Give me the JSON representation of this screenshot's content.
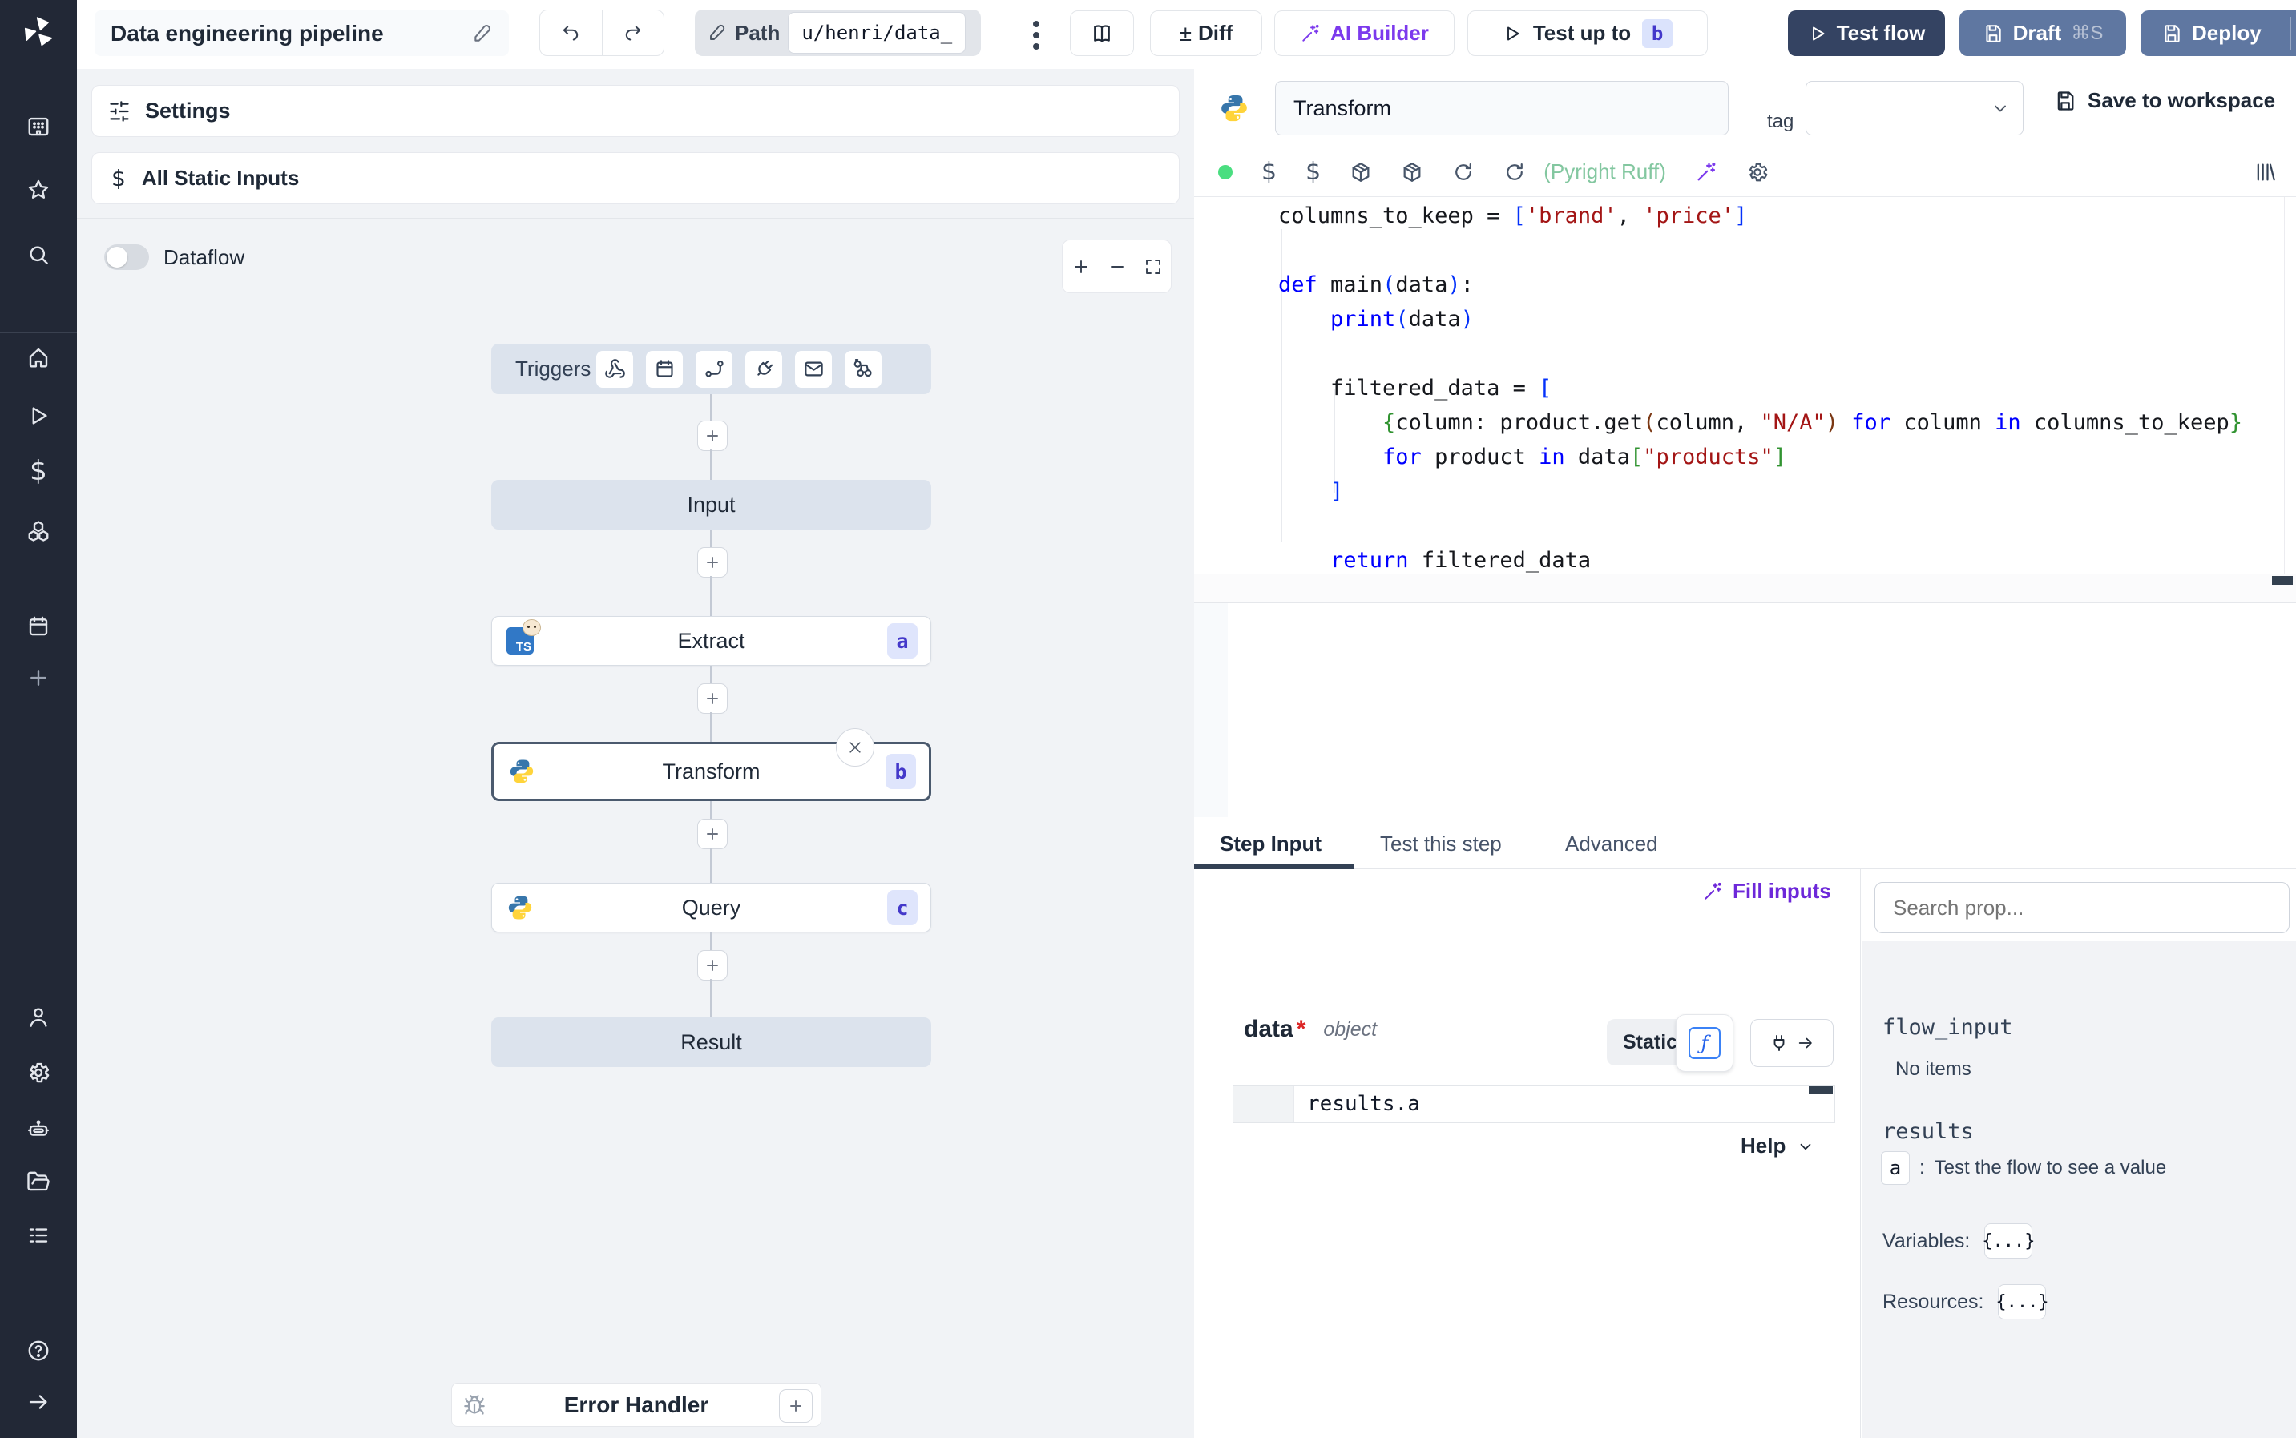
{
  "topbar": {
    "title": "Data engineering pipeline",
    "path_label": "Path",
    "path_value": "u/henri/data_",
    "book_button": "",
    "diff_label": "Diff",
    "diff_sign": "±",
    "ai_builder_label": "AI Builder",
    "test_up_to_label": "Test up to",
    "test_up_to_badge": "b",
    "test_flow_label": "Test flow",
    "draft_label": "Draft",
    "draft_shortcut": "⌘S",
    "deploy_label": "Deploy"
  },
  "sidebar": {
    "icons": [
      "windmill-logo",
      "workspace-grid",
      "favorites-star",
      "search",
      "home",
      "runs-play",
      "variables-dollar",
      "resources-cubes",
      "schedules-calendar",
      "add-plus",
      "user",
      "settings-gear",
      "workers-robot",
      "folders",
      "service-logs-list",
      "help",
      "expand-arrow"
    ]
  },
  "canvas": {
    "settings_label": "Settings",
    "static_inputs_label": "All Static Inputs",
    "static_inputs_icon": "$",
    "dataflow_label": "Dataflow",
    "triggers_label": "Triggers",
    "trigger_icons": [
      "webhook",
      "schedule-calendar",
      "http-route",
      "websocket-plug",
      "email",
      "poll"
    ],
    "nodes": {
      "input": "Input",
      "extract": {
        "label": "Extract",
        "badge": "a"
      },
      "transform": {
        "label": "Transform",
        "badge": "b"
      },
      "query": {
        "label": "Query",
        "badge": "c"
      },
      "result": "Result"
    },
    "error_handler_label": "Error Handler"
  },
  "editor": {
    "step_name": "Transform",
    "tag_label": "tag",
    "save_label": "Save to workspace",
    "lint_status": "(Pyright Ruff)",
    "toolbar_icons": [
      "status-dot",
      "dollar-vars",
      "dollar-vars",
      "package",
      "package",
      "reload",
      "reload",
      "magic-wand",
      "gear",
      "library-panel"
    ],
    "code": {
      "lines": [
        [
          [
            "columns_to_keep = ",
            "d"
          ],
          [
            "[",
            "b1"
          ],
          [
            "'brand'",
            "s"
          ],
          [
            ", ",
            "d"
          ],
          [
            "'price'",
            "s"
          ],
          [
            "]",
            "b1"
          ]
        ],
        [],
        [
          [
            "def",
            "k"
          ],
          [
            " main",
            "d"
          ],
          [
            "(",
            "b1"
          ],
          [
            "data",
            "d"
          ],
          [
            ")",
            "b1"
          ],
          [
            ":",
            "d"
          ]
        ],
        [
          [
            "    ",
            "d"
          ],
          [
            "print",
            "k"
          ],
          [
            "(",
            "b1"
          ],
          [
            "data",
            "d"
          ],
          [
            ")",
            "b1"
          ]
        ],
        [],
        [
          [
            "    filtered_data = ",
            "d"
          ],
          [
            "[",
            "b1"
          ]
        ],
        [
          [
            "        ",
            "d"
          ],
          [
            "{",
            "b2"
          ],
          [
            "column: product.get",
            "d"
          ],
          [
            "(",
            "b3"
          ],
          [
            "column, ",
            "d"
          ],
          [
            "\"N/A\"",
            "s"
          ],
          [
            ")",
            "b3"
          ],
          [
            " ",
            "d"
          ],
          [
            "for",
            "k"
          ],
          [
            " column ",
            "d"
          ],
          [
            "in",
            "k"
          ],
          [
            " columns_to_keep",
            "d"
          ],
          [
            "}",
            "b2"
          ]
        ],
        [
          [
            "        ",
            "d"
          ],
          [
            "for",
            "k"
          ],
          [
            " product ",
            "d"
          ],
          [
            "in",
            "k"
          ],
          [
            " data",
            "d"
          ],
          [
            "[",
            "b2"
          ],
          [
            "\"products\"",
            "s"
          ],
          [
            "]",
            "b2"
          ]
        ],
        [
          [
            "    ",
            "d"
          ],
          [
            "]",
            "b1"
          ]
        ],
        [],
        [
          [
            "    ",
            "d"
          ],
          [
            "return",
            "k"
          ],
          [
            " filtered_data",
            "d"
          ]
        ]
      ]
    }
  },
  "step_panel": {
    "tabs": [
      "Step Input",
      "Test this step",
      "Advanced"
    ],
    "fill_inputs_label": "Fill inputs",
    "field_name": "data",
    "field_required": "*",
    "field_type": "object",
    "static_label": "Static",
    "expr_value": "results.a",
    "help_label": "Help"
  },
  "props_panel": {
    "search_placeholder": "Search prop...",
    "flow_input_label": "flow_input",
    "no_items_label": "No items",
    "results_label": "results",
    "result_key": "a",
    "result_separator": ":",
    "result_hint": "Test the flow to see a value",
    "variables_label": "Variables:",
    "resources_label": "Resources:",
    "variables_value": "{...}",
    "resources_value": "{...}"
  },
  "colors": {
    "sidebar_bg": "#222836",
    "canvas_bg": "#f1f3f6",
    "node_steel": "#dce3ed",
    "test_flow_btn": "#344362",
    "deploy_btn": "#5f77a1",
    "accent_purple": "#7c3aed",
    "badge_bg": "#dfe5fc",
    "badge_text": "#4338ca",
    "lint_green": "#83c7a0",
    "status_dot": "#4ade80"
  }
}
